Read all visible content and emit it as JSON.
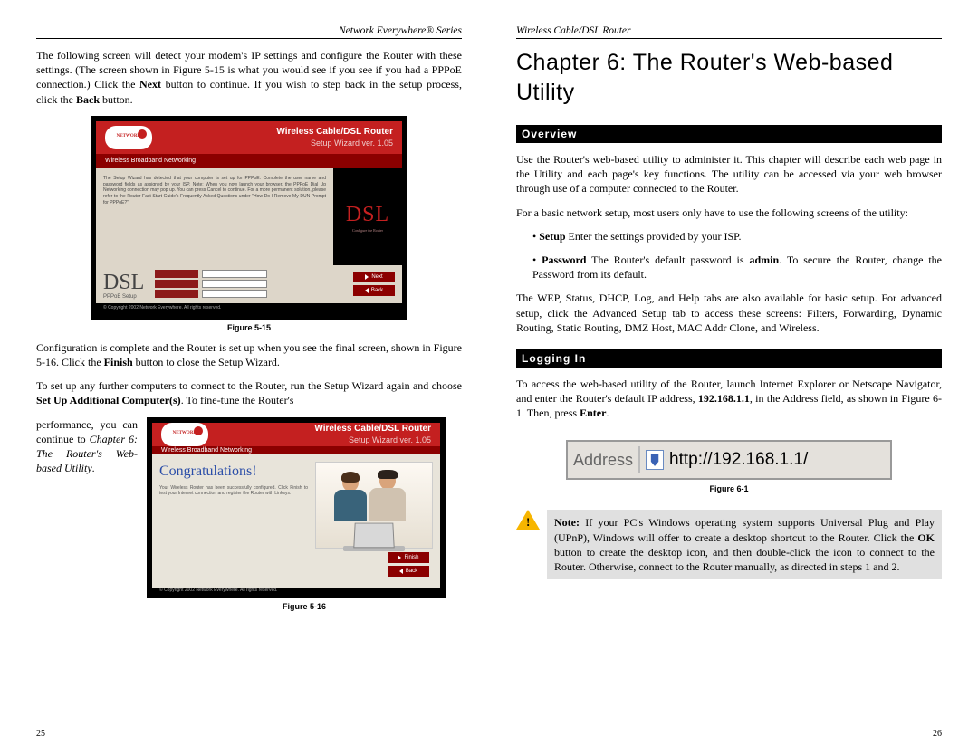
{
  "left": {
    "header": "Network Everywhere® Series",
    "page_num": "25",
    "p1_a": "The following screen will detect your modem's IP settings and configure the Router with these settings. (The screen shown in Figure 5-15 is what you would see if you see if you had a PPPoE connection.) Click the ",
    "p1_b": "Next",
    "p1_c": " button to continue. If you wish to step back in the setup process, click the ",
    "p1_d": "Back",
    "p1_e": " button.",
    "fig515": {
      "caption": "Figure 5-15",
      "router_title": "Wireless Cable/DSL Router",
      "setup_title": "Setup Wizard ver. 1.05",
      "subbar": "Wireless Broadband Networking",
      "blurb": "The Setup Wizard has detected that your computer is set up for PPPoE. Complete the user name and password fields as assigned by your ISP. Note: When you now launch your browser, the PPPoE Dial Up Networking connection may pop up. You can press Cancel to continue. For a more permanent solution, please refer to the Router Fast Start Guide's Frequently Asked Questions under \"How Do I Remove My DUN Prompt for PPPoE?\"",
      "dsl": "DSL",
      "dsl_sub": "Configure the Router",
      "pppoe": "PPPoE Setup",
      "next": "Next",
      "back": "Back",
      "copyright": "© Copyright 2002 Network Everywhere. All rights reserved."
    },
    "p2_a": "Configuration is complete and the Router is set up when you see the final screen, shown in Figure 5-16. Click the ",
    "p2_b": "Finish",
    "p2_c": " button to close the Setup Wizard.",
    "p3_a": "To set up any further computers to connect to the Router, run the Setup Wizard again and choose ",
    "p3_b": "Set Up Additional Computer(s)",
    "p3_c": ". To fine-tune the Router's",
    "wrap_a": "performance, you can continue to ",
    "wrap_b": "Chapter 6: The Router's Web-based Utility",
    "wrap_c": ".",
    "fig516": {
      "caption": "Figure 5-16",
      "router_title": "Wireless Cable/DSL Router",
      "setup_title": "Setup Wizard ver. 1.05",
      "subbar": "Wireless Broadband Networking",
      "congrats": "Congratulations!",
      "text": "Your Wireless Router has been successfully configured. Click Finish to test your Internet connection and register the Router with Linksys.",
      "finish": "Finish",
      "back": "Back",
      "copyright": "© Copyright 2002 Network Everywhere. All rights reserved."
    }
  },
  "right": {
    "header": "Wireless Cable/DSL Router",
    "page_num": "26",
    "chapter_title": "Chapter 6: The Router's Web-based Utility",
    "overview_label": "Overview",
    "ov_p1": "Use the Router's web-based utility to administer it. This chapter will describe each web page in the Utility and each page's key functions. The utility can be accessed via your web browser through use of a computer connected to the Router.",
    "ov_p2": "For a basic network setup, most users only have to use the following screens of the utility:",
    "bullet1_a": "• ",
    "bullet1_b": "Setup",
    "bullet1_c": "  Enter the settings provided by your ISP.",
    "bullet2_a": "• ",
    "bullet2_b": "Password",
    "bullet2_c": "  The Router's default password is ",
    "bullet2_d": "admin",
    "bullet2_e": ". To secure the Router, change the Password from its default.",
    "ov_p3": "The WEP, Status, DHCP, Log, and Help tabs are also available for basic setup. For advanced setup, click the Advanced Setup tab to access these screens: Filters, Forwarding, Dynamic Routing, Static Routing, DMZ Host, MAC Addr Clone, and Wireless.",
    "login_label": "Logging In",
    "login_p1_a": "To access the web-based utility of the Router, launch Internet Explorer or Netscape Navigator, and enter the Router's default IP address, ",
    "login_p1_b": "192.168.1.1",
    "login_p1_c": ", in the Address field, as shown in Figure 6-1. Then, press ",
    "login_p1_d": "Enter",
    "login_p1_e": ".",
    "fig61": {
      "caption": "Figure 6-1",
      "label": "Address",
      "url": "http://192.168.1.1/"
    },
    "note_a": "Note:",
    "note_b": " If your PC's Windows operating system supports Universal Plug and Play (UPnP), Windows will offer to create a desktop shortcut to the Router. Click the ",
    "note_c": "OK",
    "note_d": " button to create the desktop icon, and then double-click the icon to connect to the Router. Otherwise, connect to the Router manually, as directed in steps 1 and 2."
  }
}
